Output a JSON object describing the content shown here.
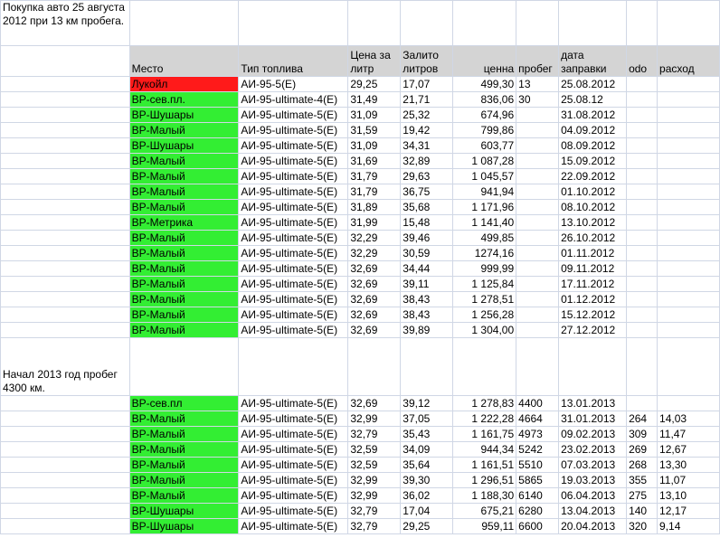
{
  "intro_note": "Покупка авто 25 августа 2012 при 13 км пробега.",
  "section2_note": "Начал 2013 год пробег 4300 км.",
  "headers": {
    "place": "Место",
    "fuel": "Тип топлива",
    "price": "Цена за литр",
    "liters": "Залито литров",
    "cost": "ценна",
    "mileage": "пробег",
    "date": "дата заправки",
    "odo": "odo",
    "consumption": "расход"
  },
  "colors": {
    "green": "#33ee33",
    "red": "#ff1a1a",
    "header": "#d4d4d4"
  },
  "rows_2012": [
    {
      "place": "Лукойл",
      "fuel": "АИ-95-5(Е)",
      "price": "29,25",
      "liters": "17,07",
      "cost": "499,30",
      "mileage": "13",
      "date": "25.08.2012",
      "odo": "",
      "consumption": "",
      "color": "red"
    },
    {
      "place": "ВР-сев.пл.",
      "fuel": "АИ-95-ultimate-4(Е)",
      "price": "31,49",
      "liters": "21,71",
      "cost": "836,06",
      "mileage": "30",
      "date": "25.08.12",
      "odo": "",
      "consumption": "",
      "color": "green"
    },
    {
      "place": "ВР-Шушары",
      "fuel": "АИ-95-ultimate-5(Е)",
      "price": "31,09",
      "liters": "25,32",
      "cost": "674,96",
      "mileage": "",
      "date": "31.08.2012",
      "odo": "",
      "consumption": "",
      "color": "green"
    },
    {
      "place": "ВР-Малый",
      "fuel": "АИ-95-ultimate-5(Е)",
      "price": "31,59",
      "liters": "19,42",
      "cost": "799,86",
      "mileage": "",
      "date": "04.09.2012",
      "odo": "",
      "consumption": "",
      "color": "green"
    },
    {
      "place": "ВР-Шушары",
      "fuel": "АИ-95-ultimate-5(Е)",
      "price": "31,09",
      "liters": "34,31",
      "cost": "603,77",
      "mileage": "",
      "date": "08.09.2012",
      "odo": "",
      "consumption": "",
      "color": "green"
    },
    {
      "place": "ВР-Малый",
      "fuel": "АИ-95-ultimate-5(Е)",
      "price": "31,69",
      "liters": "32,89",
      "cost": "1 087,28",
      "mileage": "",
      "date": "15.09.2012",
      "odo": "",
      "consumption": "",
      "color": "green"
    },
    {
      "place": "ВР-Малый",
      "fuel": "АИ-95-ultimate-5(Е)",
      "price": "31,79",
      "liters": "29,63",
      "cost": "1 045,57",
      "mileage": "",
      "date": "22.09.2012",
      "odo": "",
      "consumption": "",
      "color": "green"
    },
    {
      "place": "ВР-Малый",
      "fuel": "АИ-95-ultimate-5(Е)",
      "price": "31,79",
      "liters": "36,75",
      "cost": "941,94",
      "mileage": "",
      "date": "01.10.2012",
      "odo": "",
      "consumption": "",
      "color": "green"
    },
    {
      "place": "ВР-Малый",
      "fuel": "АИ-95-ultimate-5(Е)",
      "price": "31,89",
      "liters": "35,68",
      "cost": "1 171,96",
      "mileage": "",
      "date": "08.10.2012",
      "odo": "",
      "consumption": "",
      "color": "green"
    },
    {
      "place": "ВР-Метрика",
      "fuel": "АИ-95-ultimate-5(Е)",
      "price": "31,99",
      "liters": "15,48",
      "cost": "1 141,40",
      "mileage": "",
      "date": "13.10.2012",
      "odo": "",
      "consumption": "",
      "color": "green"
    },
    {
      "place": "ВР-Малый",
      "fuel": "АИ-95-ultimate-5(Е)",
      "price": "32,29",
      "liters": "39,46",
      "cost": "499,85",
      "mileage": "",
      "date": "26.10.2012",
      "odo": "",
      "consumption": "",
      "color": "green"
    },
    {
      "place": "ВР-Малый",
      "fuel": "АИ-95-ultimate-5(Е)",
      "price": "32,29",
      "liters": "30,59",
      "cost": "1274,16",
      "mileage": "",
      "date": "01.11.2012",
      "odo": "",
      "consumption": "",
      "color": "green"
    },
    {
      "place": "ВР-Малый",
      "fuel": "АИ-95-ultimate-5(Е)",
      "price": "32,69",
      "liters": "34,44",
      "cost": "999,99",
      "mileage": "",
      "date": "09.11.2012",
      "odo": "",
      "consumption": "",
      "color": "green"
    },
    {
      "place": "ВР-Малый",
      "fuel": "АИ-95-ultimate-5(Е)",
      "price": "32,69",
      "liters": "39,11",
      "cost": "1 125,84",
      "mileage": "",
      "date": "17.11.2012",
      "odo": "",
      "consumption": "",
      "color": "green"
    },
    {
      "place": "ВР-Малый",
      "fuel": "АИ-95-ultimate-5(Е)",
      "price": "32,69",
      "liters": "38,43",
      "cost": "1 278,51",
      "mileage": "",
      "date": "01.12.2012",
      "odo": "",
      "consumption": "",
      "color": "green"
    },
    {
      "place": "ВР-Малый",
      "fuel": "АИ-95-ultimate-5(Е)",
      "price": "32,69",
      "liters": "38,43",
      "cost": "1 256,28",
      "mileage": "",
      "date": "15.12.2012",
      "odo": "",
      "consumption": "",
      "color": "green"
    },
    {
      "place": "ВР-Малый",
      "fuel": "АИ-95-ultimate-5(Е)",
      "price": "32,69",
      "liters": "39,89",
      "cost": "1 304,00",
      "mileage": "",
      "date": "27.12.2012",
      "odo": "",
      "consumption": "",
      "color": "green"
    }
  ],
  "rows_2013": [
    {
      "place": "ВР-сев.пл",
      "fuel": "АИ-95-ultimate-5(Е)",
      "price": "32,69",
      "liters": "39,12",
      "cost": "1 278,83",
      "mileage": "4400",
      "date": "13.01.2013",
      "odo": "",
      "consumption": "",
      "color": "green"
    },
    {
      "place": "ВР-Малый",
      "fuel": "АИ-95-ultimate-5(Е)",
      "price": "32,99",
      "liters": "37,05",
      "cost": "1 222,28",
      "mileage": "4664",
      "date": "31.01.2013",
      "odo": "264",
      "consumption": "14,03",
      "color": "green"
    },
    {
      "place": "ВР-Малый",
      "fuel": "АИ-95-ultimate-5(Е)",
      "price": "32,79",
      "liters": "35,43",
      "cost": "1 161,75",
      "mileage": "4973",
      "date": "09.02.2013",
      "odo": "309",
      "consumption": "11,47",
      "color": "green"
    },
    {
      "place": "ВР-Малый",
      "fuel": "АИ-95-ultimate-5(Е)",
      "price": "32,59",
      "liters": "34,09",
      "cost": "944,34",
      "mileage": "5242",
      "date": "23.02.2013",
      "odo": "269",
      "consumption": "12,67",
      "color": "green"
    },
    {
      "place": "ВР-Малый",
      "fuel": "АИ-95-ultimate-5(Е)",
      "price": "32,59",
      "liters": "35,64",
      "cost": "1 161,51",
      "mileage": "5510",
      "date": "07.03.2013",
      "odo": "268",
      "consumption": "13,30",
      "color": "green"
    },
    {
      "place": "ВР-Малый",
      "fuel": "АИ-95-ultimate-5(Е)",
      "price": "32,99",
      "liters": "39,30",
      "cost": "1 296,51",
      "mileage": "5865",
      "date": "19.03.2013",
      "odo": "355",
      "consumption": "11,07",
      "color": "green"
    },
    {
      "place": "ВР-Малый",
      "fuel": "АИ-95-ultimate-5(Е)",
      "price": "32,99",
      "liters": "36,02",
      "cost": "1 188,30",
      "mileage": "6140",
      "date": "06.04.2013",
      "odo": "275",
      "consumption": "13,10",
      "color": "green"
    },
    {
      "place": "ВР-Шушары",
      "fuel": "АИ-95-ultimate-5(Е)",
      "price": "32,79",
      "liters": "17,04",
      "cost": "675,21",
      "mileage": "6280",
      "date": "13.04.2013",
      "odo": "140",
      "consumption": "12,17",
      "color": "green"
    },
    {
      "place": "ВР-Шушары",
      "fuel": "АИ-95-ultimate-5(Е)",
      "price": "32,79",
      "liters": "29,25",
      "cost": "959,11",
      "mileage": "6600",
      "date": "20.04.2013",
      "odo": "320",
      "consumption": "9,14",
      "color": "green"
    }
  ]
}
